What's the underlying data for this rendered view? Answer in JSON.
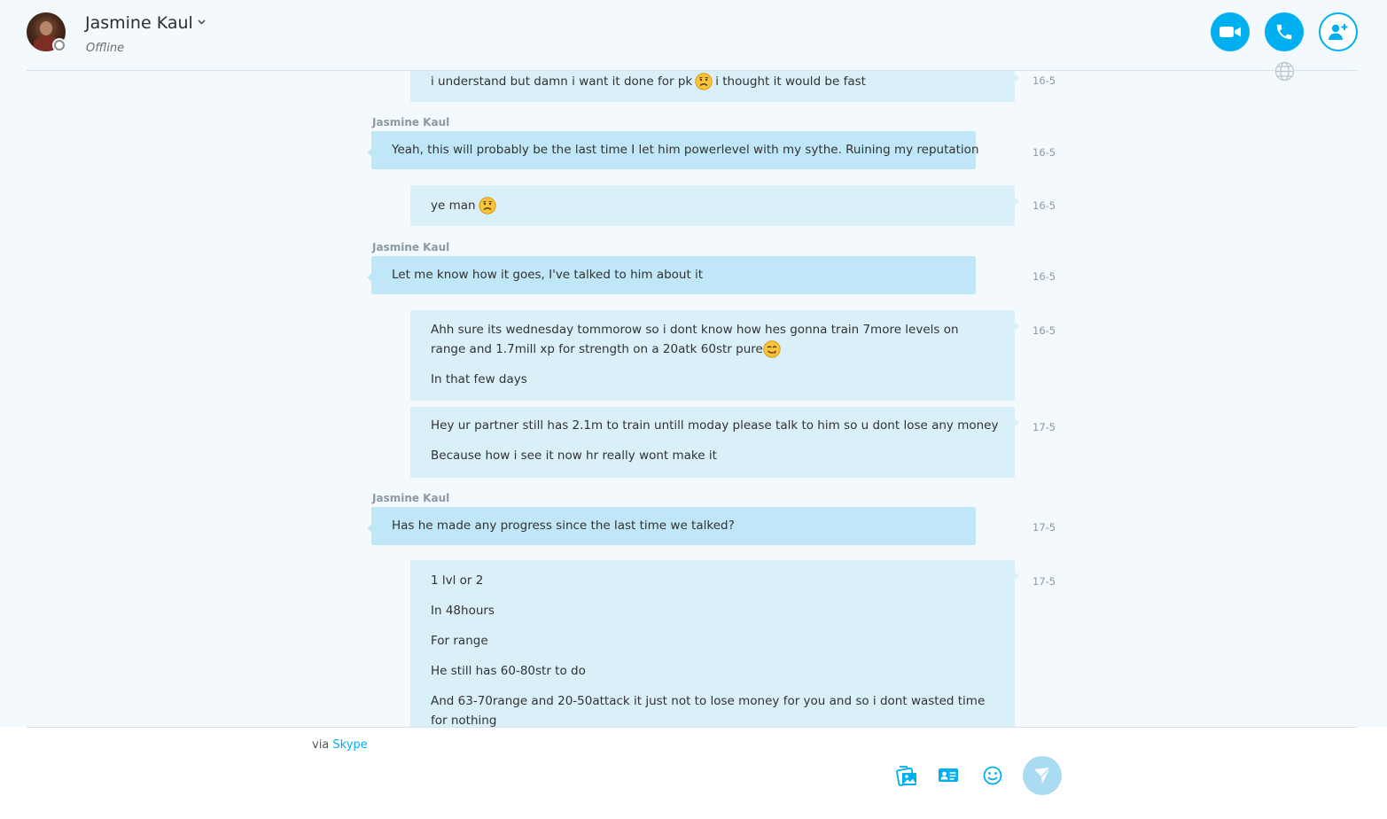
{
  "header": {
    "contact_name": "Jasmine Kaul",
    "status": "Offline"
  },
  "colors": {
    "accent": "#00aff0",
    "incoming_bubble": "#c0e7f7",
    "outgoing_bubble": "#daf0f9",
    "background": "#f3f9fc"
  },
  "icons": {
    "video_call": "video-camera-icon",
    "audio_call": "phone-icon",
    "add_people": "add-person-icon",
    "translate": "globe-icon",
    "send_image": "image-icon",
    "send_contact": "contact-card-icon",
    "emoticons": "smiley-icon",
    "send": "send-icon"
  },
  "messages": [
    {
      "dir": "out",
      "lines": [
        "i understand but damn i want it done for pk",
        "i thought it would be fast"
      ],
      "time": "16-5"
    },
    {
      "dir": "in",
      "sender": "Jasmine Kaul",
      "lines": [
        "Yeah, this will probably be the last time I let him powerlevel with my sythe. Ruining my reputation"
      ],
      "time": "16-5"
    },
    {
      "dir": "out",
      "lines": [
        "ye man"
      ],
      "time": "16-5"
    },
    {
      "dir": "in",
      "sender": "Jasmine Kaul",
      "lines": [
        "Let me know how it goes, I've talked to him about it"
      ],
      "time": "16-5"
    },
    {
      "dir": "out",
      "lines": [
        "Ahh sure its wednesday tommorow so i dont know how hes gonna train 7more levels on range and 1.7mill xp for strength on a 20atk 60str pure",
        "In that few days"
      ],
      "time": "16-5"
    },
    {
      "dir": "out",
      "lines": [
        "Hey ur partner still has 2.1m to train untill moday please talk to him so u dont lose any money",
        "Because how i see it now hr really wont make it"
      ],
      "time": "17-5"
    },
    {
      "dir": "in",
      "sender": "Jasmine Kaul",
      "lines": [
        "Has he made any progress since the last time we talked?"
      ],
      "time": "17-5"
    },
    {
      "dir": "out",
      "lines": [
        "1 lvl or 2",
        "In 48hours",
        "For range",
        "He still has 60-80str to do",
        "And 63-70range and 20-50attack it just not to lose money for you and so i dont wasted time for nothing"
      ],
      "time": "17-5"
    }
  ],
  "footer": {
    "via_prefix": "via",
    "via_link": "Skype"
  }
}
